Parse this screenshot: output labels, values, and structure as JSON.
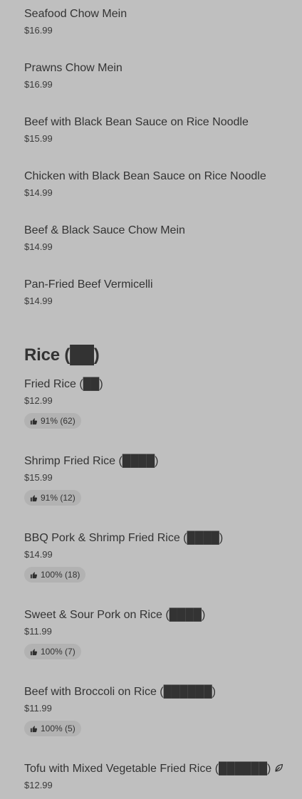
{
  "items_top": [
    {
      "name": "Seafood Chow Mein",
      "price": "$16.99"
    },
    {
      "name": "Prawns Chow Mein",
      "price": "$16.99"
    },
    {
      "name": "Beef with Black Bean Sauce on Rice Noodle",
      "price": "$15.99"
    },
    {
      "name": "Chicken with Black Bean Sauce on Rice Noodle",
      "price": "$14.99"
    },
    {
      "name": "Beef & Black Sauce Chow Mein",
      "price": "$14.99"
    },
    {
      "name": "Pan-Fried Beef Vermicelli",
      "price": "$14.99"
    }
  ],
  "section": {
    "title": "Rice (██)",
    "icons": {
      "thumb": "thumbs-up-icon",
      "leaf": "leaf-icon"
    }
  },
  "rice_items": [
    {
      "name": "Fried Rice (██)",
      "price": "$12.99",
      "rating": "91% (62)"
    },
    {
      "name": "Shrimp Fried Rice (████)",
      "price": "$15.99",
      "rating": "91% (12)"
    },
    {
      "name": "BBQ Pork & Shrimp Fried Rice (████)",
      "price": "$14.99",
      "rating": "100% (18)"
    },
    {
      "name": "Sweet & Sour Pork on Rice (████)",
      "price": "$11.99",
      "rating": "100% (7)"
    },
    {
      "name": "Beef with Broccoli on Rice (██████)",
      "price": "$11.99",
      "rating": "100% (5)"
    },
    {
      "name": "Tofu with Mixed Vegetable Fried Rice (██████)",
      "price": "$12.99",
      "vegetarian": true
    }
  ]
}
